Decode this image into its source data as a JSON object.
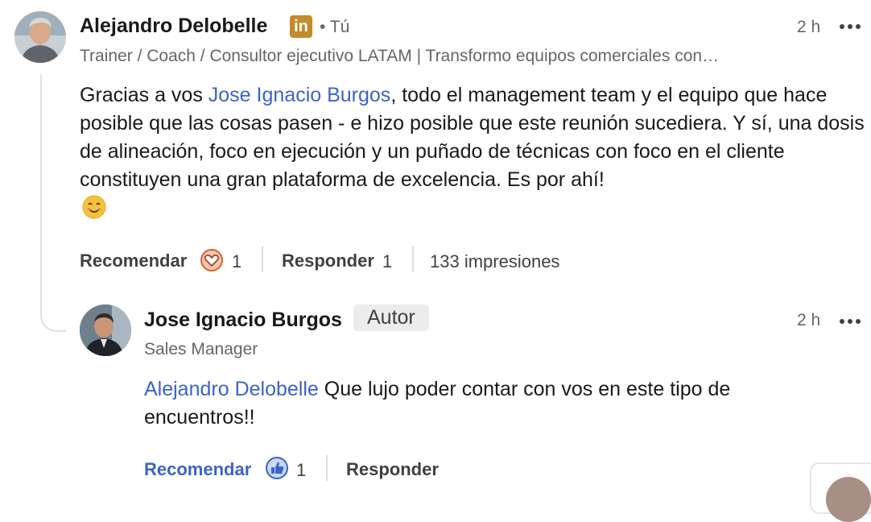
{
  "comment": {
    "author": "Alejandro Delobelle",
    "network_badge": "• Tú",
    "headline": "Trainer / Coach / Consultor ejecutivo LATAM | Transformo equipos comerciales con…",
    "time": "2 h",
    "text_prefix": "Gracias a vos ",
    "mention": "Jose Ignacio Burgos",
    "text_rest": ", todo el management team y el equipo que hace posible que las cosas pasen - e hizo posible que este reunión sucediera. Y sí, una dosis de alineación, foco en ejecución y un puñado de técnicas con foco en el cliente constituyen una gran plataforma de excelencia. Es por ahí!",
    "emoji": "😊",
    "like_label": "Recomendar",
    "like_count": "1",
    "reply_label": "Responder",
    "reply_count": "1",
    "impressions": "133 impresiones",
    "linkedin_icon_text": "in"
  },
  "reply": {
    "author": "Jose Ignacio Burgos",
    "badge": "Autor",
    "headline": "Sales Manager",
    "time": "2 h",
    "mention": "Alejandro Delobelle",
    "text": " Que lujo poder contar con vos en este tipo de encuentros!!",
    "like_label": "Recomendar",
    "like_count": "1",
    "reply_label": "Responder"
  },
  "colors": {
    "mention": "#3c63c6",
    "linkedin_gold": "#c58a2b",
    "love": "#d9622b",
    "like_blue": "#3c63c6"
  }
}
